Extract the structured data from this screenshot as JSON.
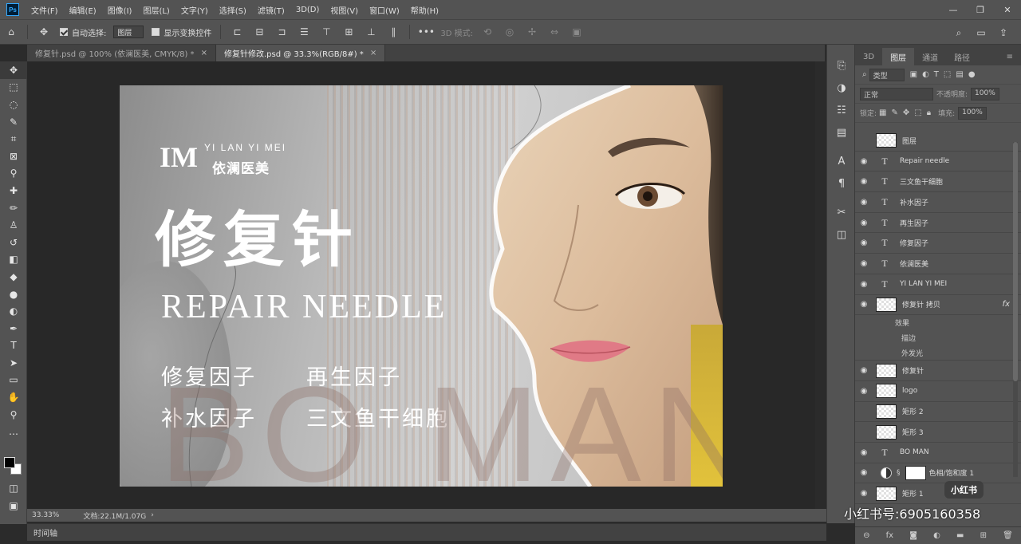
{
  "menu": [
    "文件(F)",
    "编辑(E)",
    "图像(I)",
    "图层(L)",
    "文字(Y)",
    "选择(S)",
    "滤镜(T)",
    "3D(D)",
    "视图(V)",
    "窗口(W)",
    "帮助(H)"
  ],
  "options": {
    "auto_select_label": "自动选择:",
    "auto_select_value": "图层",
    "show_transform_label": "显示变换控件",
    "mode_3d_label": "3D 模式:"
  },
  "tabs": [
    {
      "label": "修复针.psd @ 100% (依澜医美, CMYK/8) *",
      "active": false
    },
    {
      "label": "修复针修改.psd @ 33.3%(RGB/8#) *",
      "active": true
    }
  ],
  "artwork": {
    "logo_mark": "IM",
    "logo_en": "YI LAN YI MEI",
    "logo_cn": "依澜医美",
    "title_cn": "修复针",
    "title_en": "REPAIR NEEDLE",
    "features": [
      "修复因子",
      "再生因子",
      "补水因子",
      "三文鱼干细胞"
    ],
    "bo_man": "BO MAN"
  },
  "status": {
    "zoom": "33.33%",
    "doc": "文档:22.1M/1.07G"
  },
  "timeline_label": "时间轴",
  "panel": {
    "tabs": [
      "3D",
      "图层",
      "通道",
      "路径"
    ],
    "active_tab": "图层",
    "filter_kind": "类型",
    "blend_mode": "正常",
    "opacity_label": "不透明度:",
    "opacity_value": "100%",
    "lock_label": "锁定:",
    "fill_label": "填充:",
    "fill_value": "100%"
  },
  "layers": [
    {
      "name": "图层",
      "visible": false,
      "kind": "pixel"
    },
    {
      "name": "Repair needle",
      "visible": true,
      "kind": "text"
    },
    {
      "name": "三文鱼干细胞",
      "visible": true,
      "kind": "text"
    },
    {
      "name": "补水因子",
      "visible": true,
      "kind": "text"
    },
    {
      "name": "再生因子",
      "visible": true,
      "kind": "text"
    },
    {
      "name": "修复因子",
      "visible": true,
      "kind": "text"
    },
    {
      "name": "依澜医美",
      "visible": true,
      "kind": "text"
    },
    {
      "name": "YI LAN YI MEI",
      "visible": true,
      "kind": "text"
    },
    {
      "name": "修复针 拷贝",
      "visible": true,
      "kind": "pixel",
      "fx": "fx"
    },
    {
      "name": "效果",
      "visible": false,
      "kind": "sub"
    },
    {
      "name": "描边",
      "visible": false,
      "kind": "sub"
    },
    {
      "name": "外发光",
      "visible": false,
      "kind": "sub"
    },
    {
      "name": "修复针",
      "visible": true,
      "kind": "pixel"
    },
    {
      "name": "logo",
      "visible": true,
      "kind": "pixel"
    },
    {
      "name": "矩形 2",
      "visible": false,
      "kind": "pixel"
    },
    {
      "name": "矩形 3",
      "visible": false,
      "kind": "pixel"
    },
    {
      "name": "BO MAN",
      "visible": true,
      "kind": "text"
    },
    {
      "name": "色相/饱和度 1",
      "visible": true,
      "kind": "adjust"
    },
    {
      "name": "矩形 1",
      "visible": true,
      "kind": "pixel"
    }
  ],
  "watermark": {
    "badge": "小红书",
    "text": "小红书号:6905160358"
  },
  "colors": {
    "ui_dark": "#535353",
    "canvas_bg": "#282828",
    "accent_blue": "#31a8ff",
    "skin": "#d7b895",
    "lip": "#e07a86",
    "yellow": "#e2c23b"
  }
}
